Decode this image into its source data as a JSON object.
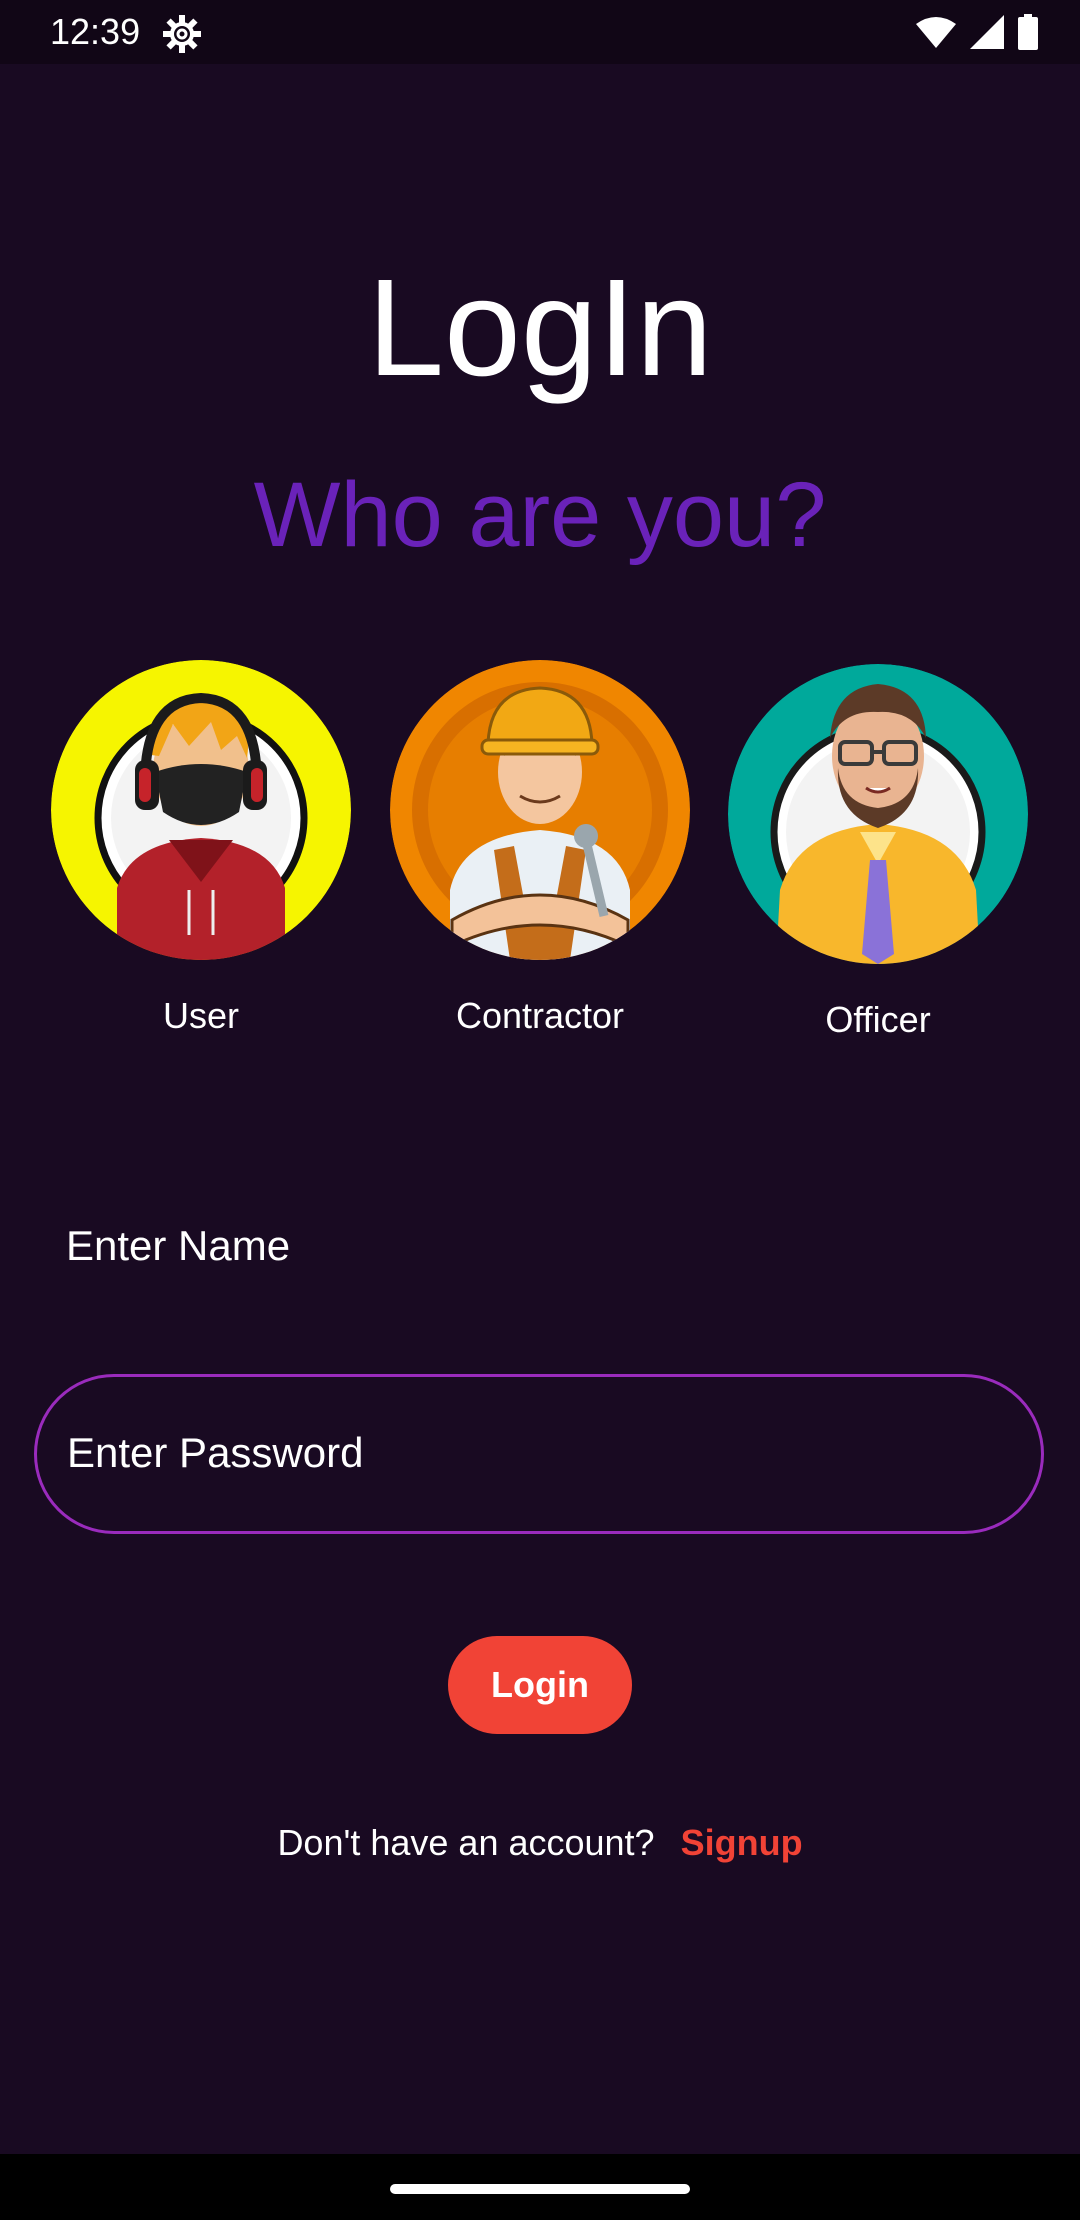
{
  "status_bar": {
    "time": "12:39",
    "icons": [
      "settings-icon",
      "wifi-icon",
      "signal-icon",
      "battery-icon"
    ]
  },
  "title": "LogIn",
  "subtitle": "Who are you?",
  "roles": [
    {
      "label": "User",
      "icon": "user-avatar",
      "color": "#f6f500"
    },
    {
      "label": "Contractor",
      "icon": "contractor-avatar",
      "color": "#f08600"
    },
    {
      "label": "Officer",
      "icon": "officer-avatar",
      "color": "#00a99b"
    }
  ],
  "form": {
    "name_placeholder": "Enter Name",
    "password_placeholder": "Enter Password",
    "login_label": "Login"
  },
  "signup": {
    "prompt": "Don't have an account?",
    "link": "Signup"
  },
  "colors": {
    "background": "#190a22",
    "accent_purple": "#6a22b9",
    "accent_red": "#f14336",
    "field_border": "#9a2bbd"
  }
}
